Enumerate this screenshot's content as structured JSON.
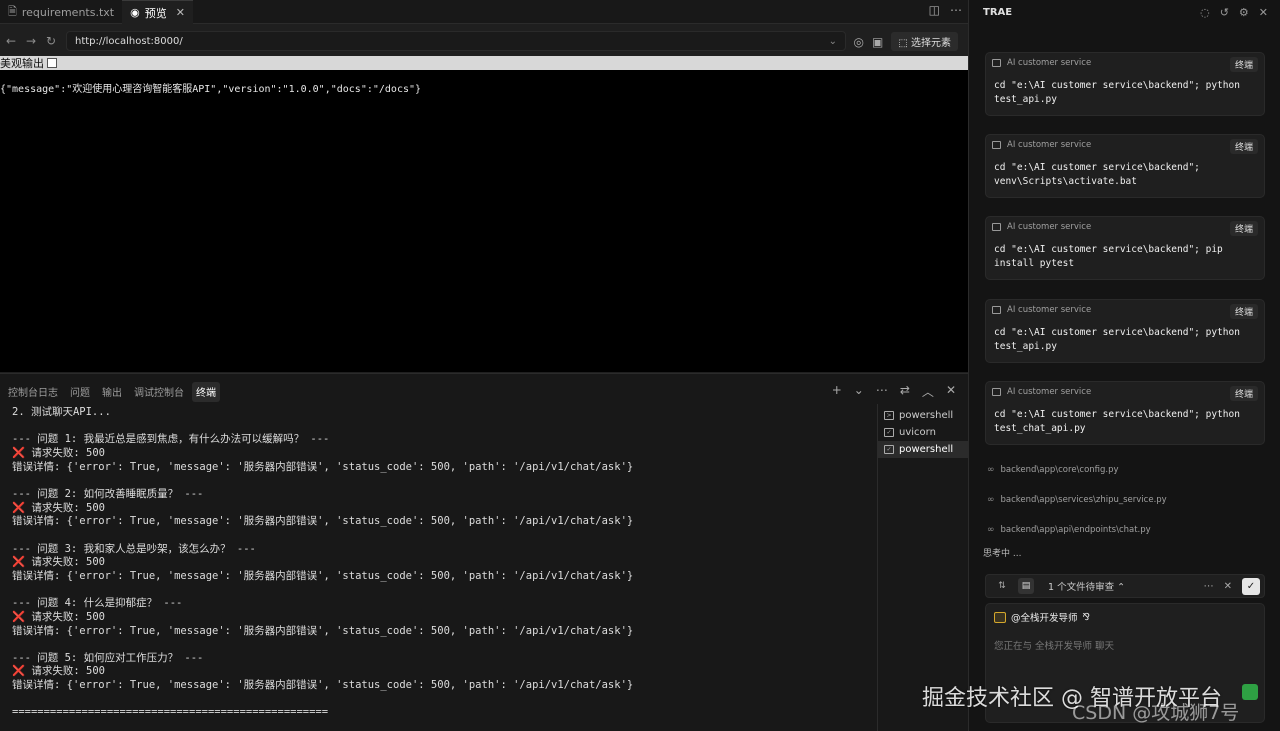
{
  "tabs": [
    {
      "label": "requirements.txt",
      "icon": "file-icon"
    },
    {
      "label": "预览",
      "icon": "eye-icon"
    }
  ],
  "browser": {
    "url": "http://localhost:8000/",
    "select_element": "选择元素"
  },
  "preview": {
    "pretty_label": "美观输出",
    "json_body": "{\"message\":\"欢迎使用心理咨询智能客服API\",\"version\":\"1.0.0\",\"docs\":\"/docs\"}"
  },
  "panel": {
    "tabs": [
      "控制台日志",
      "问题",
      "输出",
      "调试控制台",
      "终端"
    ],
    "active_tab": "终端"
  },
  "terminal": {
    "lines": [
      "2. 测试聊天API...",
      "",
      "--- 问题 1: 我最近总是感到焦虑，有什么办法可以缓解吗？ ---",
      "❌ 请求失败: 500",
      "错误详情: {'error': True, 'message': '服务器内部错误', 'status_code': 500, 'path': '/api/v1/chat/ask'}",
      "",
      "--- 问题 2: 如何改善睡眠质量？ ---",
      "❌ 请求失败: 500",
      "错误详情: {'error': True, 'message': '服务器内部错误', 'status_code': 500, 'path': '/api/v1/chat/ask'}",
      "",
      "--- 问题 3: 我和家人总是吵架，该怎么办？ ---",
      "❌ 请求失败: 500",
      "错误详情: {'error': True, 'message': '服务器内部错误', 'status_code': 500, 'path': '/api/v1/chat/ask'}",
      "",
      "--- 问题 4: 什么是抑郁症？ ---",
      "❌ 请求失败: 500",
      "错误详情: {'error': True, 'message': '服务器内部错误', 'status_code': 500, 'path': '/api/v1/chat/ask'}",
      "",
      "--- 问题 5: 如何应对工作压力？ ---",
      "❌ 请求失败: 500",
      "错误详情: {'error': True, 'message': '服务器内部错误', 'status_code': 500, 'path': '/api/v1/chat/ask'}",
      "",
      "=================================================="
    ],
    "sessions": [
      {
        "label": "powershell",
        "active": false
      },
      {
        "label": "uvicorn",
        "active": false
      },
      {
        "label": "powershell",
        "active": true
      }
    ]
  },
  "trae": {
    "title": "TRAE",
    "cards": [
      {
        "context": "AI customer service",
        "button": "终端",
        "command": "cd \"e:\\AI customer service\\backend\"; python test_api.py"
      },
      {
        "context": "AI customer service",
        "button": "终端",
        "command": "cd \"e:\\AI customer service\\backend\"; venv\\Scripts\\activate.bat"
      },
      {
        "context": "AI customer service",
        "button": "终端",
        "command": "cd \"e:\\AI customer service\\backend\"; pip install pytest"
      },
      {
        "context": "AI customer service",
        "button": "终端",
        "command": "cd \"e:\\AI customer service\\backend\"; python test_api.py"
      },
      {
        "context": "AI customer service",
        "button": "终端",
        "command": "cd \"e:\\AI customer service\\backend\"; python test_chat_api.py"
      }
    ],
    "files": [
      "backend\\app\\core\\config.py",
      "backend\\app\\services\\zhipu_service.py",
      "backend\\app\\api\\endpoints\\chat.py"
    ],
    "thinking": "思考中 ...",
    "review_label": "1 个文件待审查",
    "agent_name": "@全栈开发导师",
    "input_placeholder": "您正在与 全栈开发导师 聊天"
  },
  "watermark": {
    "text": "掘金技术社区 @ 智谱开放平台",
    "text2": "CSDN @攻城狮7号"
  },
  "colors": {
    "error": "#e5484d",
    "send": "#2ea043"
  }
}
